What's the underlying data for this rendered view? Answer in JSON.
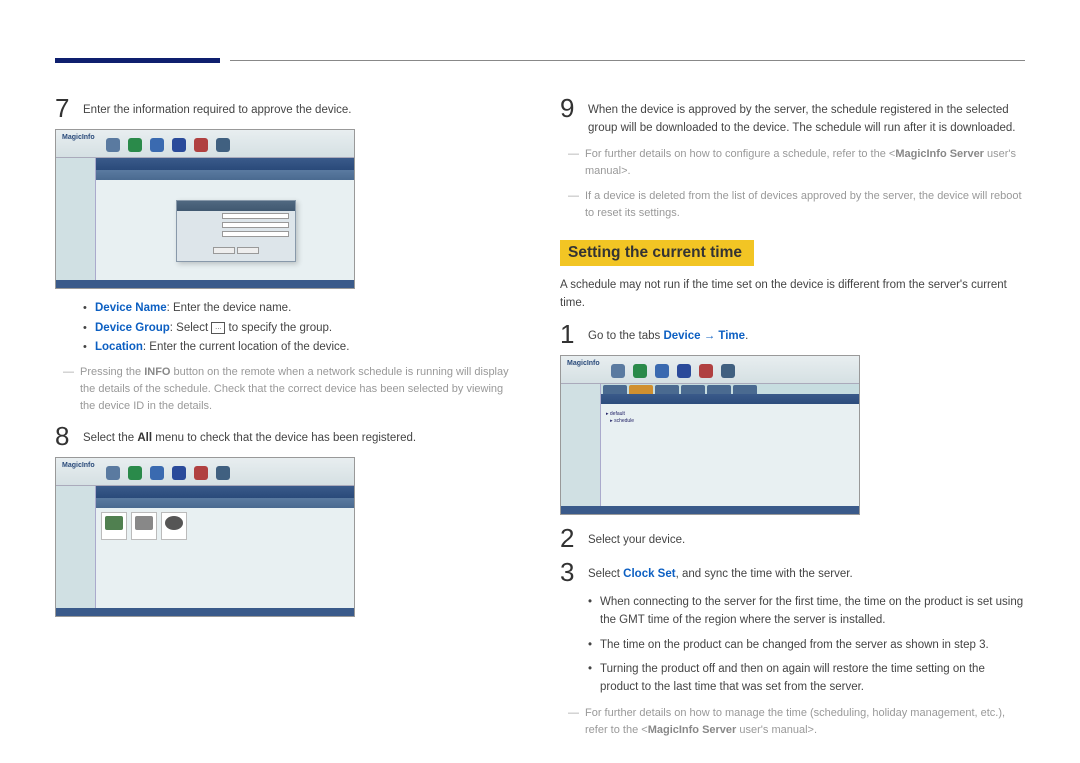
{
  "header": {},
  "left": {
    "step7": {
      "num": "7",
      "text": "Enter the information required to approve the device."
    },
    "shot1": {
      "logo": "MagicInfo"
    },
    "bullets": {
      "device_name_label": "Device Name",
      "device_name_text": ": Enter the device name.",
      "device_group_label": "Device Group",
      "device_group_before": ": Select ",
      "device_group_icon": "…",
      "device_group_after": " to specify the group.",
      "location_label": "Location",
      "location_text": ": Enter the current location of the device."
    },
    "note1_before": "Pressing the ",
    "note1_bold": "INFO",
    "note1_after": " button on the remote when a network schedule is running will display the details of the schedule. Check that the correct device has been selected by viewing the device ID in the details.",
    "step8": {
      "num": "8",
      "before": "Select the ",
      "bold": "All",
      "after": " menu to check that the device has been registered."
    },
    "shot2": {
      "logo": "MagicInfo"
    }
  },
  "right": {
    "step9": {
      "num": "9",
      "text": "When the device is approved by the server, the schedule registered in the selected group will be downloaded to the device. The schedule will run after it is downloaded."
    },
    "note2_before": "For further details on how to configure a schedule, refer to the <",
    "note2_bold": "MagicInfo Server",
    "note2_after": " user's manual>.",
    "note3": "If a device is deleted from the list of devices approved by the server, the device will reboot to reset its settings.",
    "heading": "Setting the current time",
    "intro": "A schedule may not run if the time set on the device is different from the server's current time.",
    "step1": {
      "num": "1",
      "before": "Go to the tabs ",
      "bold1": "Device",
      "arrow": " → ",
      "bold2": "Time",
      "after": "."
    },
    "shot3": {
      "logo": "MagicInfo"
    },
    "step2": {
      "num": "2",
      "text": "Select your device."
    },
    "step3": {
      "num": "3",
      "before": "Select ",
      "bold": "Clock Set",
      "after": ", and sync the time with the server."
    },
    "sub_bullets": {
      "b1": "When connecting to the server for the first time, the time on the product is set using the GMT time of the region where the server is installed.",
      "b2": "The time on the product can be changed from the server as shown in step 3.",
      "b3": "Turning the product off and then on again will restore the time setting on the product to the last time that was set from the server."
    },
    "note4_before": "For further details on how to manage the time (scheduling, holiday management, etc.), refer to the <",
    "note4_bold": "MagicInfo Server",
    "note4_after": " user's manual>."
  }
}
